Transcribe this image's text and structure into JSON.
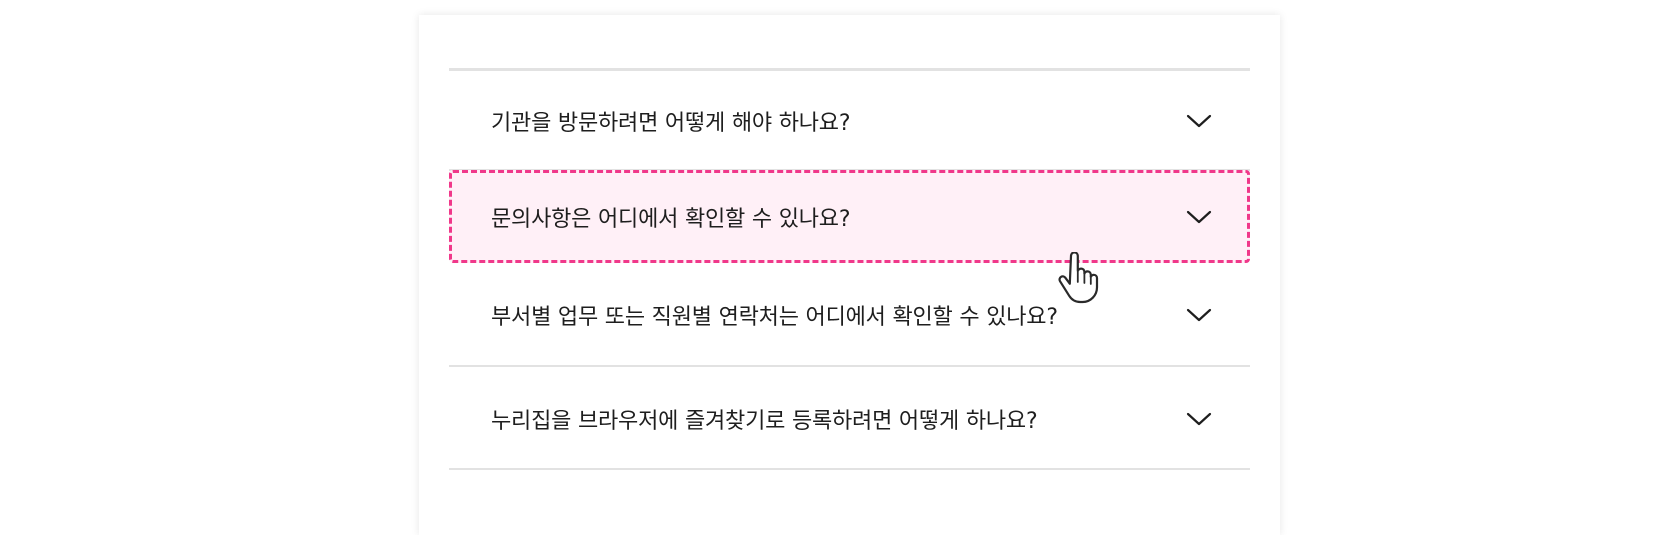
{
  "faq": {
    "items": [
      {
        "question": "기관을 방문하려면 어떻게 해야 하나요?",
        "expanded": false
      },
      {
        "question": "문의사항은 어디에서 확인할 수 있나요?",
        "expanded": false,
        "hovered": true
      },
      {
        "question": "부서별 업무 또는 직원별 연락처는 어디에서 확인할 수 있나요?",
        "expanded": false
      },
      {
        "question": "누리집을 브라우저에 즐겨찾기로 등록하려면 어떻게 하나요?",
        "expanded": false
      }
    ],
    "expand_icon": "chevron-down-icon",
    "colors": {
      "focus_border": "#f0388a",
      "focus_background": "#fff0f7",
      "divider": "#e2e2e2",
      "text": "#1e1e1e"
    }
  }
}
